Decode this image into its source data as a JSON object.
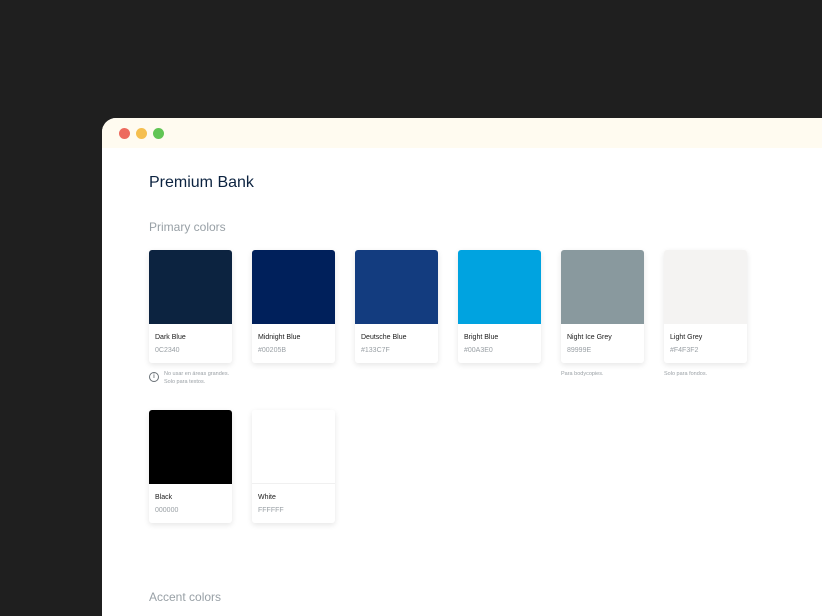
{
  "window_controls": [
    {
      "name": "close",
      "color": "#ed6a5e"
    },
    {
      "name": "minimize",
      "color": "#f5bf4f"
    },
    {
      "name": "maximize",
      "color": "#61c554"
    }
  ],
  "page_title": "Premium Bank",
  "sections": {
    "primary_title": "Primary colors",
    "accent_title": "Accent colors"
  },
  "swatches": [
    {
      "name": "Dark Blue",
      "hex": "0C2340",
      "color": "#0C2340"
    },
    {
      "name": "Midnight Blue",
      "hex": "#00205B",
      "color": "#00205B"
    },
    {
      "name": "Deutsche Blue",
      "hex": "#133C7F",
      "color": "#133C7F"
    },
    {
      "name": "Bright Blue",
      "hex": "#00A3E0",
      "color": "#00A3E0"
    },
    {
      "name": "Night Ice Grey",
      "hex": "89999E",
      "color": "#89999E"
    },
    {
      "name": "Light Grey",
      "hex": "#F4F3F2",
      "color": "#F4F3F2"
    },
    {
      "name": "Black",
      "hex": "000000",
      "color": "#000000"
    },
    {
      "name": "White",
      "hex": "FFFFFF",
      "color": "#FFFFFF"
    }
  ],
  "notes": {
    "dark_blue_line1": "No usar en áreas grandes.",
    "dark_blue_line2": "Solo para textos.",
    "night_ice_grey": "Para bodycopies.",
    "light_grey": "Solo para fondos."
  },
  "icons": {
    "info": "i"
  }
}
